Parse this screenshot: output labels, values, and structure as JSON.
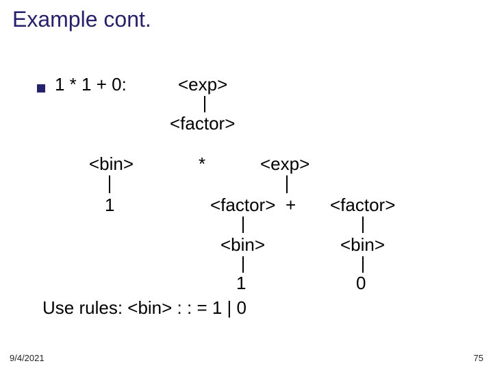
{
  "title": "Example cont.",
  "expression": "1 * 1 + 0:",
  "nodes": {
    "exp1": "<exp>",
    "factor1": "<factor>",
    "bin1": "<bin>",
    "star": "*",
    "exp2": "<exp>",
    "leaf_bin1": "1",
    "factor2": "<factor>",
    "plus": "+",
    "factor3": "<factor>",
    "bin2": "<bin>",
    "bin3": "<bin>",
    "leaf_bin2": "1",
    "leaf_bin3": "0"
  },
  "rule_line": "Use rules:  <bin> : : = 1 | 0",
  "footer": {
    "date": "9/4/2021",
    "pagenum": "75"
  }
}
